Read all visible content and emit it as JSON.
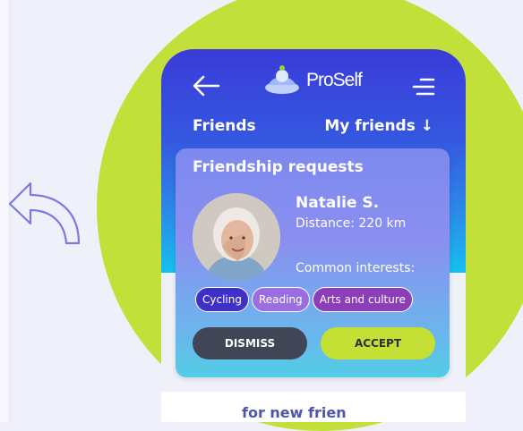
{
  "app": {
    "name": "ProSelf"
  },
  "header": {
    "section_title": "Friends",
    "dropdown_label": "My friends ↓"
  },
  "request_card": {
    "title": "Friendship requests",
    "person": {
      "name": "Natalie S.",
      "distance": "Distance: 220 km",
      "common_label": "Common interests:"
    },
    "interests": [
      {
        "label": "Cycling",
        "color": "#3f31c8"
      },
      {
        "label": "Reading",
        "color": "#9a6ee0"
      },
      {
        "label": "Arts and culture",
        "color": "#8c3db8"
      }
    ],
    "dismiss_label": "DISMISS",
    "accept_label": "ACCEPT"
  },
  "bottom": {
    "text": "for new frien"
  },
  "colors": {
    "accent_green": "#c3e03a",
    "header_blue": "#3a3bd8",
    "dark_button": "#414656"
  }
}
